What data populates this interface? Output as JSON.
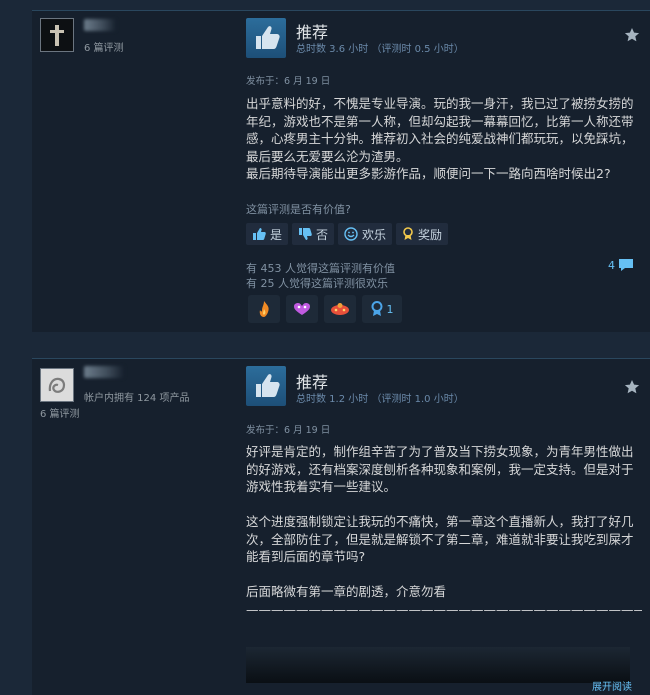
{
  "reviews": [
    {
      "user": {
        "reviews_count": "6 篇评测",
        "products_owned": ""
      },
      "verdict": "推荐",
      "hours": "总时数 3.6 小时 （评测时 0.5 小时）",
      "posted": "发布于：6 月 19 日",
      "body": "出乎意料的好，不愧是专业导演。玩的我一身汗，我已过了被捞女捞的年纪，游戏也不是第一人称，但却勾起我一幕幕回忆，比第一人称还带感，心疼男主十分钟。推荐初入社会的纯爱战神们都玩玩，以免踩坑，最后要么无爱要么沦为渣男。\n最后期待导演能出更多影游作品，顺便问一下一路向西啥时候出2?",
      "helpful_question": "这篇评测是否有价值?",
      "buttons": {
        "yes": "是",
        "no": "否",
        "funny": "欢乐",
        "award": "奖励"
      },
      "helpful_count": "有 453 人觉得这篇评测有价值",
      "funny_count": "有 25 人觉得这篇评测很欢乐",
      "comment_count": "4",
      "awards": [
        {
          "icon": "flame-award-icon",
          "color": "#f08a24"
        },
        {
          "icon": "heart-award-icon",
          "color": "#c05ae0"
        },
        {
          "icon": "bubble-award-icon",
          "color": "#e8503a"
        },
        {
          "icon": "medal-award-icon",
          "color": "#4ba4e8",
          "count": "1"
        }
      ]
    },
    {
      "user": {
        "reviews_count": "6 篇评测",
        "products_owned": "帐户内拥有 124 项产品"
      },
      "verdict": "推荐",
      "hours": "总时数 1.2 小时 （评测时 1.0 小时）",
      "posted": "发布于：6 月 19 日",
      "body": "好评是肯定的，制作组辛苦了为了普及当下捞女现象，为青年男性做出的好游戏，还有档案深度刨析各种现象和案例，我一定支持。但是对于游戏性我着实有一些建议。\n\n这个进度强制锁定让我玩的不痛快，第一章这个直播新人，我打了好几次，全部防住了，但是就是解锁不了第二章，难道就非要让我吃到屎才能看到后面的章节吗?\n\n后面略微有第一章的剧透，介意勿看\n————————————————————————————————————————————————————————————————————————",
      "expand": "展开阅读"
    }
  ]
}
